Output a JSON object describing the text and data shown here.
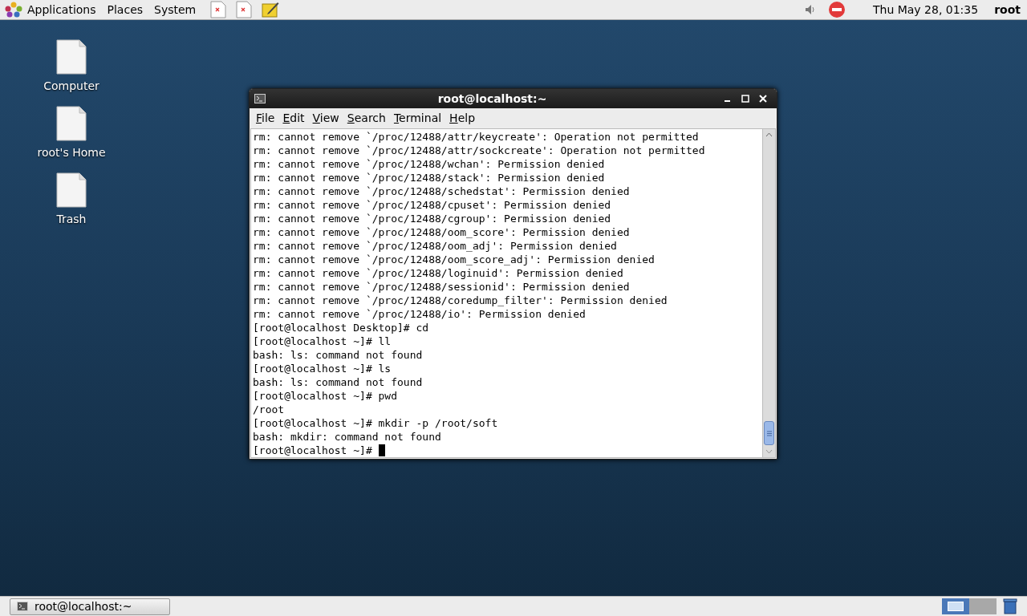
{
  "top_panel": {
    "menus": [
      "Applications",
      "Places",
      "System"
    ],
    "launchers": [
      {
        "kind": "doc"
      },
      {
        "kind": "doc"
      },
      {
        "kind": "note"
      }
    ],
    "clock": "Thu May 28, 01:35",
    "user": "root"
  },
  "desktop_icons": [
    "Computer",
    "root's Home",
    "Trash"
  ],
  "window": {
    "title": "root@localhost:~",
    "menus": [
      "File",
      "Edit",
      "View",
      "Search",
      "Terminal",
      "Help"
    ],
    "lines": [
      "rm: cannot remove `/proc/12488/attr/keycreate': Operation not permitted",
      "rm: cannot remove `/proc/12488/attr/sockcreate': Operation not permitted",
      "rm: cannot remove `/proc/12488/wchan': Permission denied",
      "rm: cannot remove `/proc/12488/stack': Permission denied",
      "rm: cannot remove `/proc/12488/schedstat': Permission denied",
      "rm: cannot remove `/proc/12488/cpuset': Permission denied",
      "rm: cannot remove `/proc/12488/cgroup': Permission denied",
      "rm: cannot remove `/proc/12488/oom_score': Permission denied",
      "rm: cannot remove `/proc/12488/oom_adj': Permission denied",
      "rm: cannot remove `/proc/12488/oom_score_adj': Permission denied",
      "rm: cannot remove `/proc/12488/loginuid': Permission denied",
      "rm: cannot remove `/proc/12488/sessionid': Permission denied",
      "rm: cannot remove `/proc/12488/coredump_filter': Permission denied",
      "rm: cannot remove `/proc/12488/io': Permission denied",
      "[root@localhost Desktop]# cd",
      "[root@localhost ~]# ll",
      "bash: ls: command not found",
      "[root@localhost ~]# ls",
      "bash: ls: command not found",
      "[root@localhost ~]# pwd",
      "/root",
      "[root@localhost ~]# mkdir -p /root/soft",
      "bash: mkdir: command not found",
      "[root@localhost ~]# "
    ]
  },
  "taskbar": {
    "tasks": [
      {
        "label": "root@localhost:~",
        "selected": false
      }
    ],
    "workspaces": [
      {
        "selected": true
      },
      {
        "selected": false
      }
    ]
  }
}
